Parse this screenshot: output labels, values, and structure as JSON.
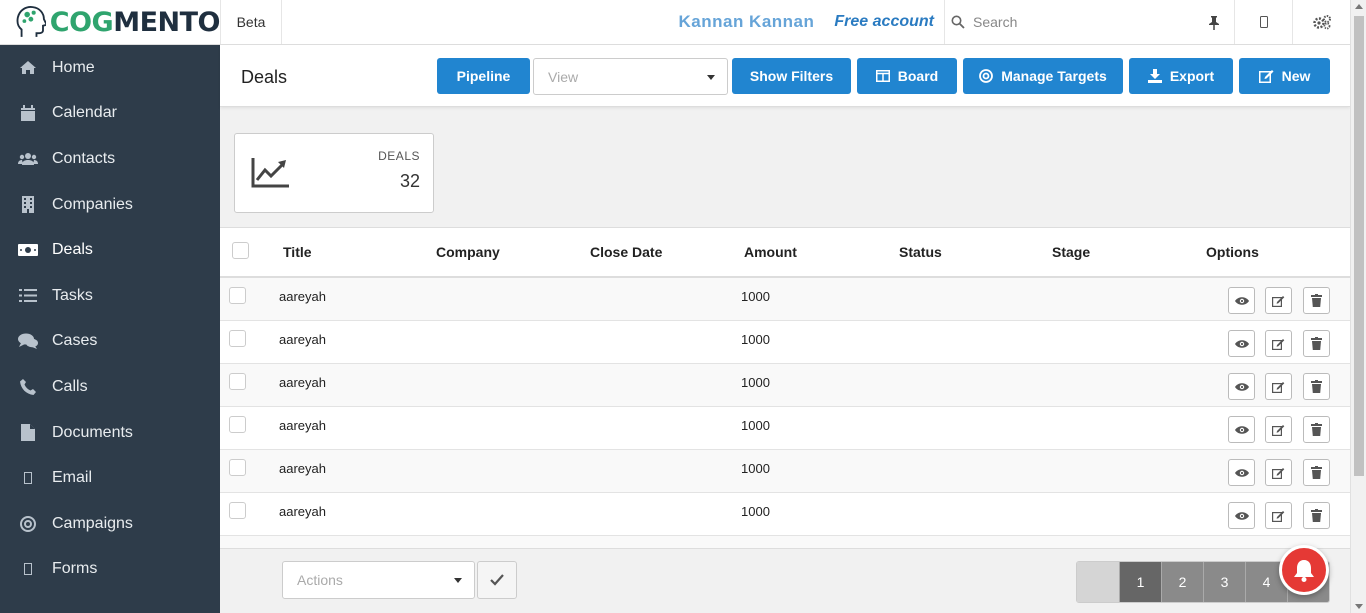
{
  "brand": {
    "logo_part1": "COG",
    "logo_part2": "MENTO",
    "tag": "Beta"
  },
  "header": {
    "user_name": "Kannan Kannan",
    "account": "Free account",
    "search_placeholder": "Search"
  },
  "sidebar": {
    "items": [
      {
        "label": "Home",
        "icon": "home-icon"
      },
      {
        "label": "Calendar",
        "icon": "calendar-icon"
      },
      {
        "label": "Contacts",
        "icon": "users-icon"
      },
      {
        "label": "Companies",
        "icon": "building-icon"
      },
      {
        "label": "Deals",
        "icon": "money-icon"
      },
      {
        "label": "Tasks",
        "icon": "tasks-icon"
      },
      {
        "label": "Cases",
        "icon": "comments-icon"
      },
      {
        "label": "Calls",
        "icon": "phone-icon"
      },
      {
        "label": "Documents",
        "icon": "file-icon"
      },
      {
        "label": "Email",
        "icon": "email-icon"
      },
      {
        "label": "Campaigns",
        "icon": "bullseye-icon"
      },
      {
        "label": "Forms",
        "icon": "form-icon"
      }
    ],
    "active": "Deals"
  },
  "page": {
    "title": "Deals",
    "view_placeholder": "View",
    "buttons": {
      "pipeline": "Pipeline",
      "show_filters": "Show Filters",
      "board": "Board",
      "manage_targets": "Manage Targets",
      "export": "Export",
      "new": "New"
    }
  },
  "stats": {
    "label": "DEALS",
    "value": "32"
  },
  "table": {
    "columns": [
      "Title",
      "Company",
      "Close Date",
      "Amount",
      "Status",
      "Stage",
      "Options"
    ],
    "rows": [
      {
        "title": "aareyah",
        "company": "",
        "close_date": "",
        "amount": "1000",
        "status": "",
        "stage": ""
      },
      {
        "title": "aareyah",
        "company": "",
        "close_date": "",
        "amount": "1000",
        "status": "",
        "stage": ""
      },
      {
        "title": "aareyah",
        "company": "",
        "close_date": "",
        "amount": "1000",
        "status": "",
        "stage": ""
      },
      {
        "title": "aareyah",
        "company": "",
        "close_date": "",
        "amount": "1000",
        "status": "",
        "stage": ""
      },
      {
        "title": "aareyah",
        "company": "",
        "close_date": "",
        "amount": "1000",
        "status": "",
        "stage": ""
      },
      {
        "title": "aareyah",
        "company": "",
        "close_date": "",
        "amount": "1000",
        "status": "",
        "stage": ""
      }
    ]
  },
  "footer": {
    "actions_placeholder": "Actions",
    "pages": [
      "1",
      "2",
      "3",
      "4"
    ]
  },
  "colors": {
    "primary": "#2185d0",
    "sidebar": "#2e3c4a",
    "brand_green": "#2fa46e",
    "notification": "#e53935"
  }
}
